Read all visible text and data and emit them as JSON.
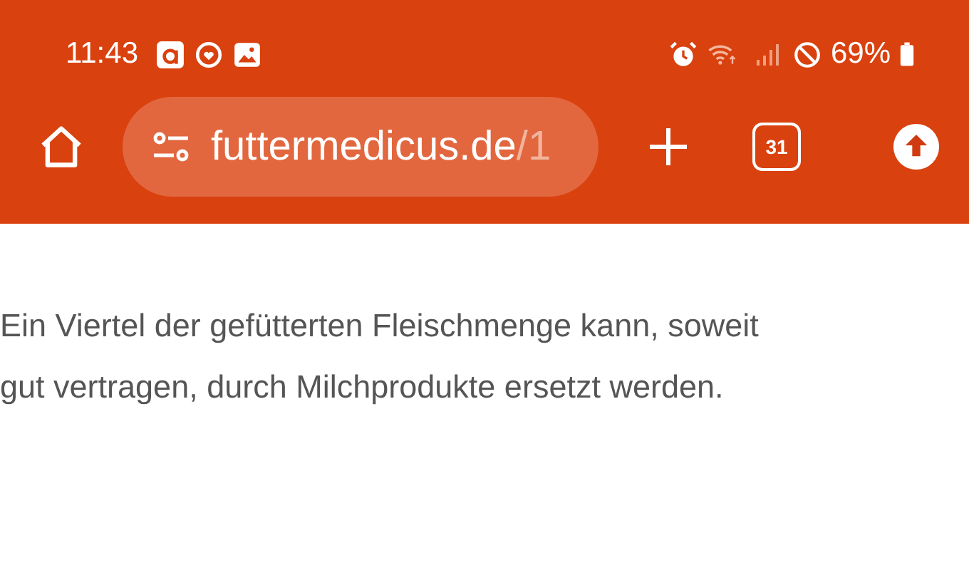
{
  "status_bar": {
    "time": "11:43",
    "battery": "69%"
  },
  "toolbar": {
    "url_host": "futtermedicus.de",
    "url_path": "/1",
    "tab_count": "31"
  },
  "content": {
    "paragraph_lines": [
      "Ein Viertel der gefütterten Fleischmenge kann, soweit",
      "gut vertragen, durch Milchprodukte ersetzt werden."
    ]
  }
}
